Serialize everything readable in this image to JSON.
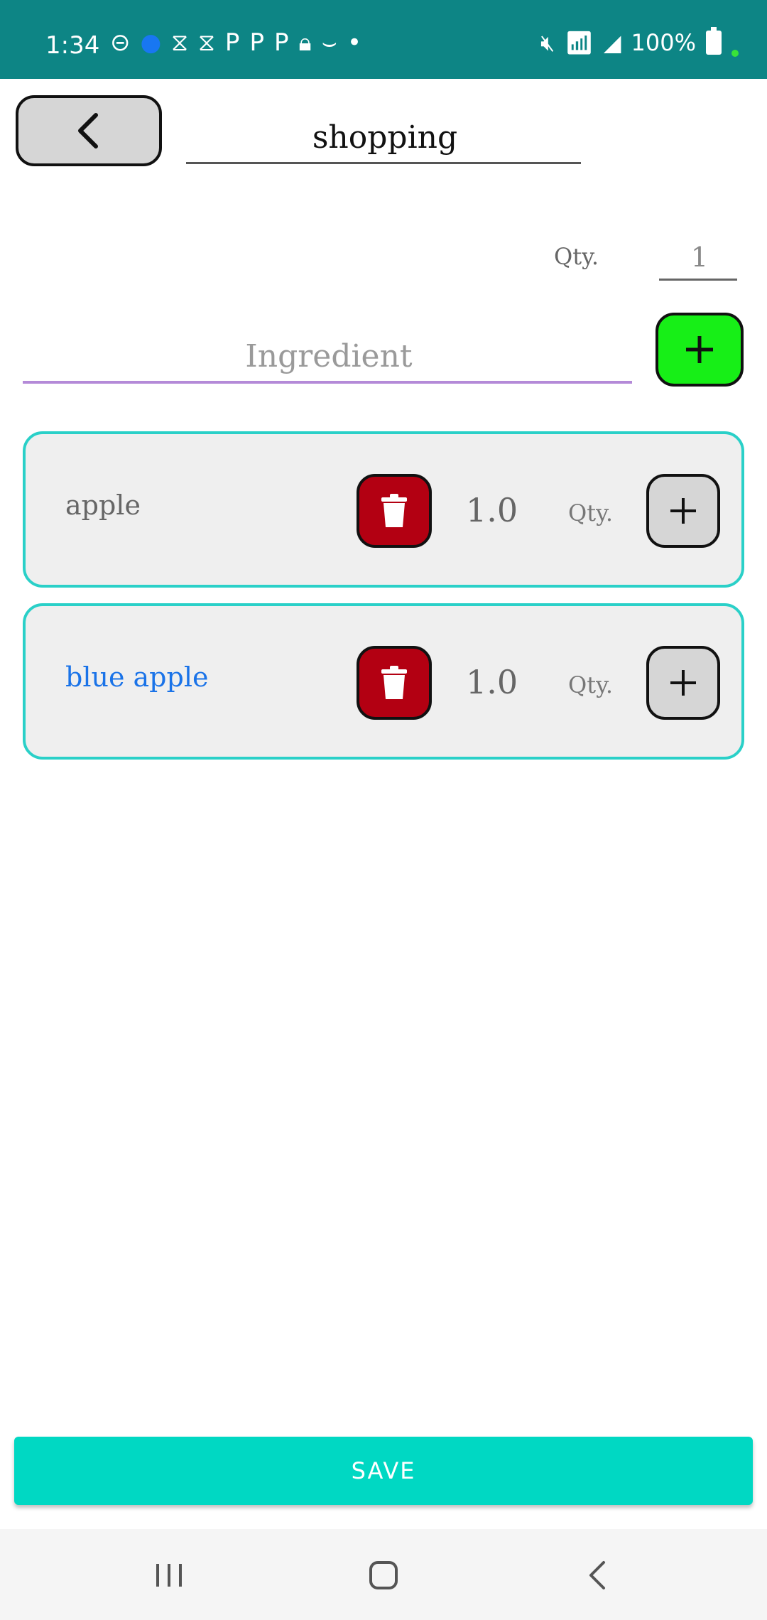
{
  "status_bar": {
    "time": "1:34",
    "battery": "100%",
    "background": "#0d8585"
  },
  "header": {
    "back_icon": "chevron-left-icon",
    "title_value": "shopping"
  },
  "quantity": {
    "label": "Qty.",
    "value": "1"
  },
  "ingredient_input": {
    "placeholder": "Ingredient",
    "add_icon": "plus-icon"
  },
  "items": [
    {
      "name": "apple",
      "qty": "1.0",
      "qty_label": "Qty.",
      "name_color": "#666666"
    },
    {
      "name": "blue apple",
      "qty": "1.0",
      "qty_label": "Qty.",
      "name_color": "#1a73e8"
    }
  ],
  "save_button": {
    "label": "SAVE",
    "color": "#00d8c3"
  },
  "colors": {
    "add_button": "#17ef17",
    "delete_button": "#b30012",
    "card_border": "#2ad0c8",
    "ingredient_underline": "#b48ad8"
  }
}
